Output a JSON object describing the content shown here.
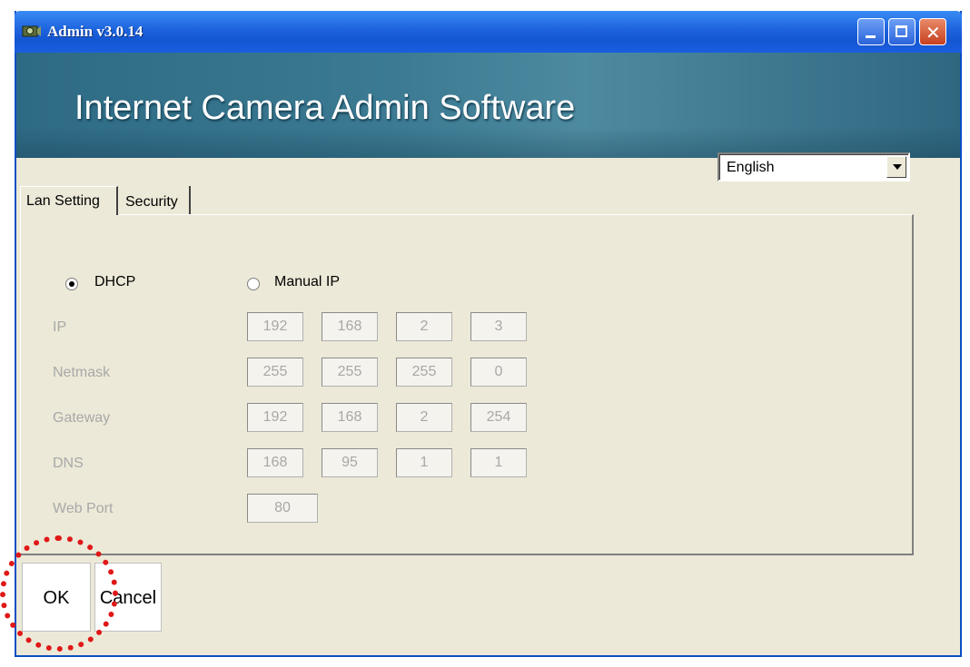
{
  "window": {
    "title": "Admin v3.0.14",
    "icon": "camera-app-icon",
    "controls": {
      "minimize": "minimize-icon",
      "maximize": "maximize-icon",
      "close_glyph": "✕"
    }
  },
  "banner": {
    "title": "Internet Camera Admin Software"
  },
  "language": {
    "selected": "English"
  },
  "tabs": [
    {
      "label": "Lan Setting",
      "active": true
    },
    {
      "label": "Security",
      "active": false
    }
  ],
  "mode": {
    "dhcp_label": "DHCP",
    "manual_label": "Manual IP",
    "selected": "DHCP"
  },
  "fields": {
    "ip": {
      "label": "IP",
      "values": [
        "192",
        "168",
        "2",
        "3"
      ]
    },
    "netmask": {
      "label": "Netmask",
      "values": [
        "255",
        "255",
        "255",
        "0"
      ]
    },
    "gateway": {
      "label": "Gateway",
      "values": [
        "192",
        "168",
        "2",
        "254"
      ]
    },
    "dns": {
      "label": "DNS",
      "values": [
        "168",
        "95",
        "1",
        "1"
      ]
    },
    "web_port": {
      "label": "Web Port",
      "value": "80"
    }
  },
  "buttons": {
    "ok": "OK",
    "cancel": "Cancel"
  },
  "colors": {
    "titlebar": "#1d63dd",
    "banner": "#3b7a92",
    "dialog": "#ece9d8",
    "annotation": "#e01818"
  }
}
